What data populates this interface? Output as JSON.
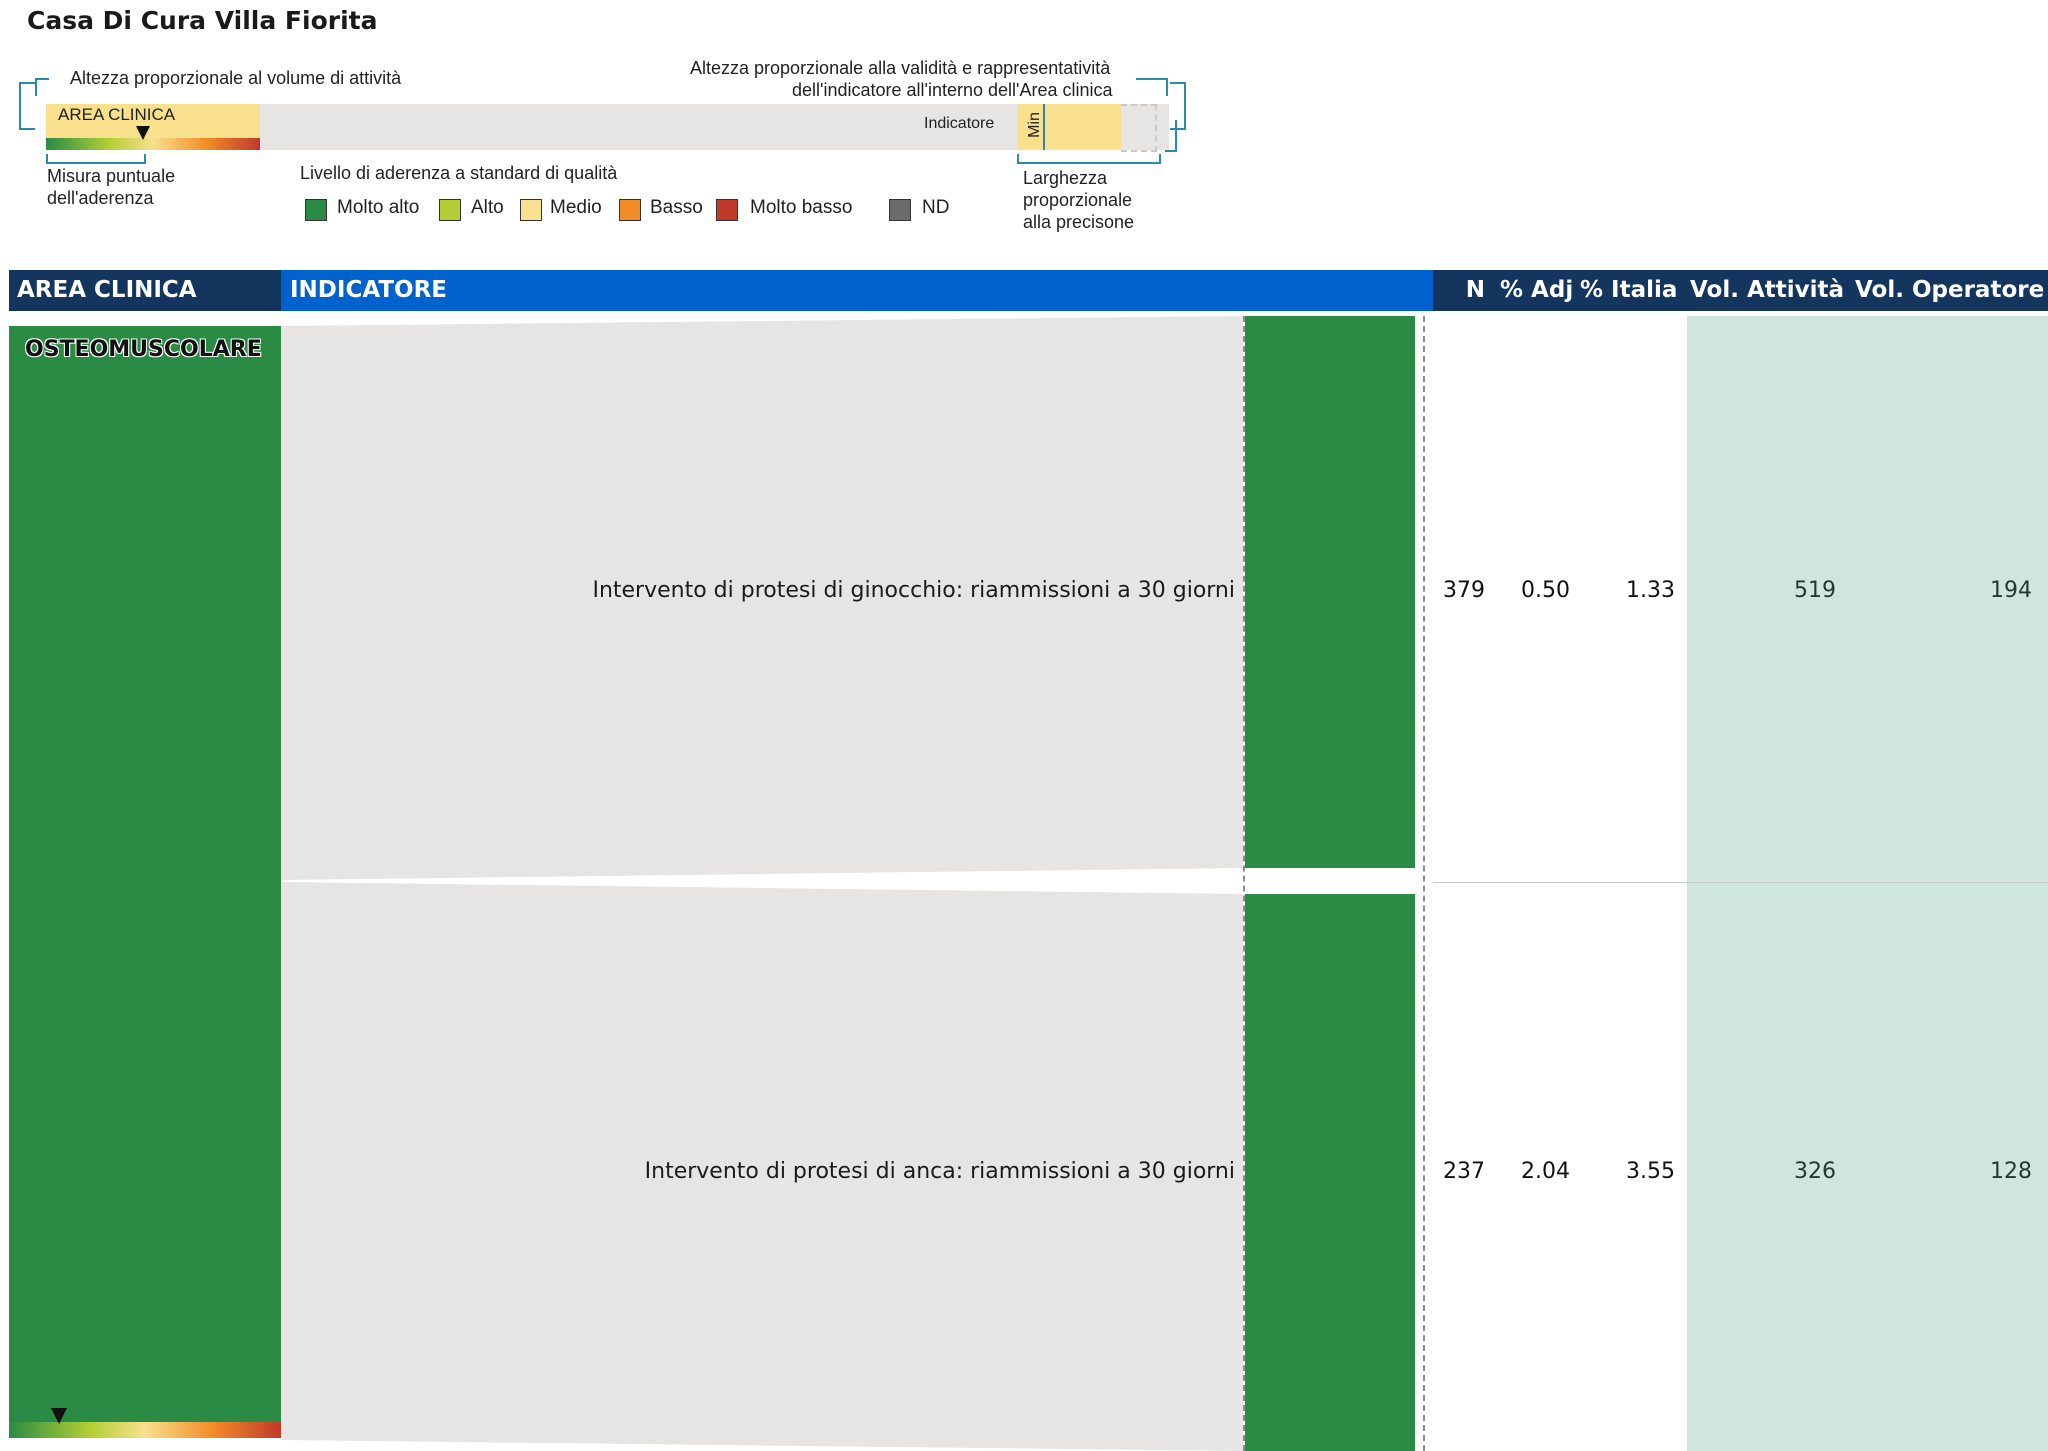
{
  "page": {
    "title": "Casa Di Cura Villa Fiorita"
  },
  "legend": {
    "height_volume_label": "Altezza proporzionale al volume di attività",
    "height_validity_label_line1": "Altezza proporzionale alla validità e rappresentatività",
    "height_validity_label_line2": "dell'indicatore all'interno dell'Area clinica",
    "area_box_label": "AREA CLINICA",
    "indicator_label": "Indicatore",
    "min_label": "Min",
    "point_measure_line1": "Misura puntuale",
    "point_measure_line2": "dell'aderenza",
    "adherence_title": "Livello di aderenza a standard di qualità",
    "width_precision_line1": "Larghezza",
    "width_precision_line2": "proporzionale",
    "width_precision_line3": "alla precisone",
    "levels": [
      {
        "label": "Molto alto",
        "color": "#2a8c44"
      },
      {
        "label": "Alto",
        "color": "#b4cf35"
      },
      {
        "label": "Medio",
        "color": "#f8e08c"
      },
      {
        "label": "Basso",
        "color": "#f28c28"
      },
      {
        "label": "Molto basso",
        "color": "#c0392b"
      },
      {
        "label": "ND",
        "color": "#6b6b6b"
      }
    ]
  },
  "table": {
    "headers": {
      "area": "AREA CLINICA",
      "indicator": "INDICATORE",
      "n": "N",
      "adj": "% Adj",
      "italia": "% Italia",
      "vol_attivita": "Vol. Attività",
      "vol_operatore": "Vol. Operatore"
    },
    "area": {
      "name": "OSTEOMUSCOLARE",
      "level": "Molto alto",
      "color": "#2a8c44"
    },
    "rows": [
      {
        "indicator": "Intervento di protesi di ginocchio: riammissioni a 30 giorni",
        "n": "379",
        "adj": "0.50",
        "italia": "1.33",
        "vol_attivita": "519",
        "vol_operatore": "194",
        "level": "Molto alto"
      },
      {
        "indicator": "Intervento di protesi di anca: riammissioni a 30 giorni",
        "n": "237",
        "adj": "2.04",
        "italia": "3.55",
        "vol_attivita": "326",
        "vol_operatore": "128",
        "level": "Molto alto"
      }
    ]
  },
  "colors": {
    "header_dark": "#14365e",
    "header_blue": "#0062cc",
    "band_grey": "#e6e5e3",
    "volume_bg": "#cfe6dc",
    "bracket": "#2a8aa8"
  }
}
